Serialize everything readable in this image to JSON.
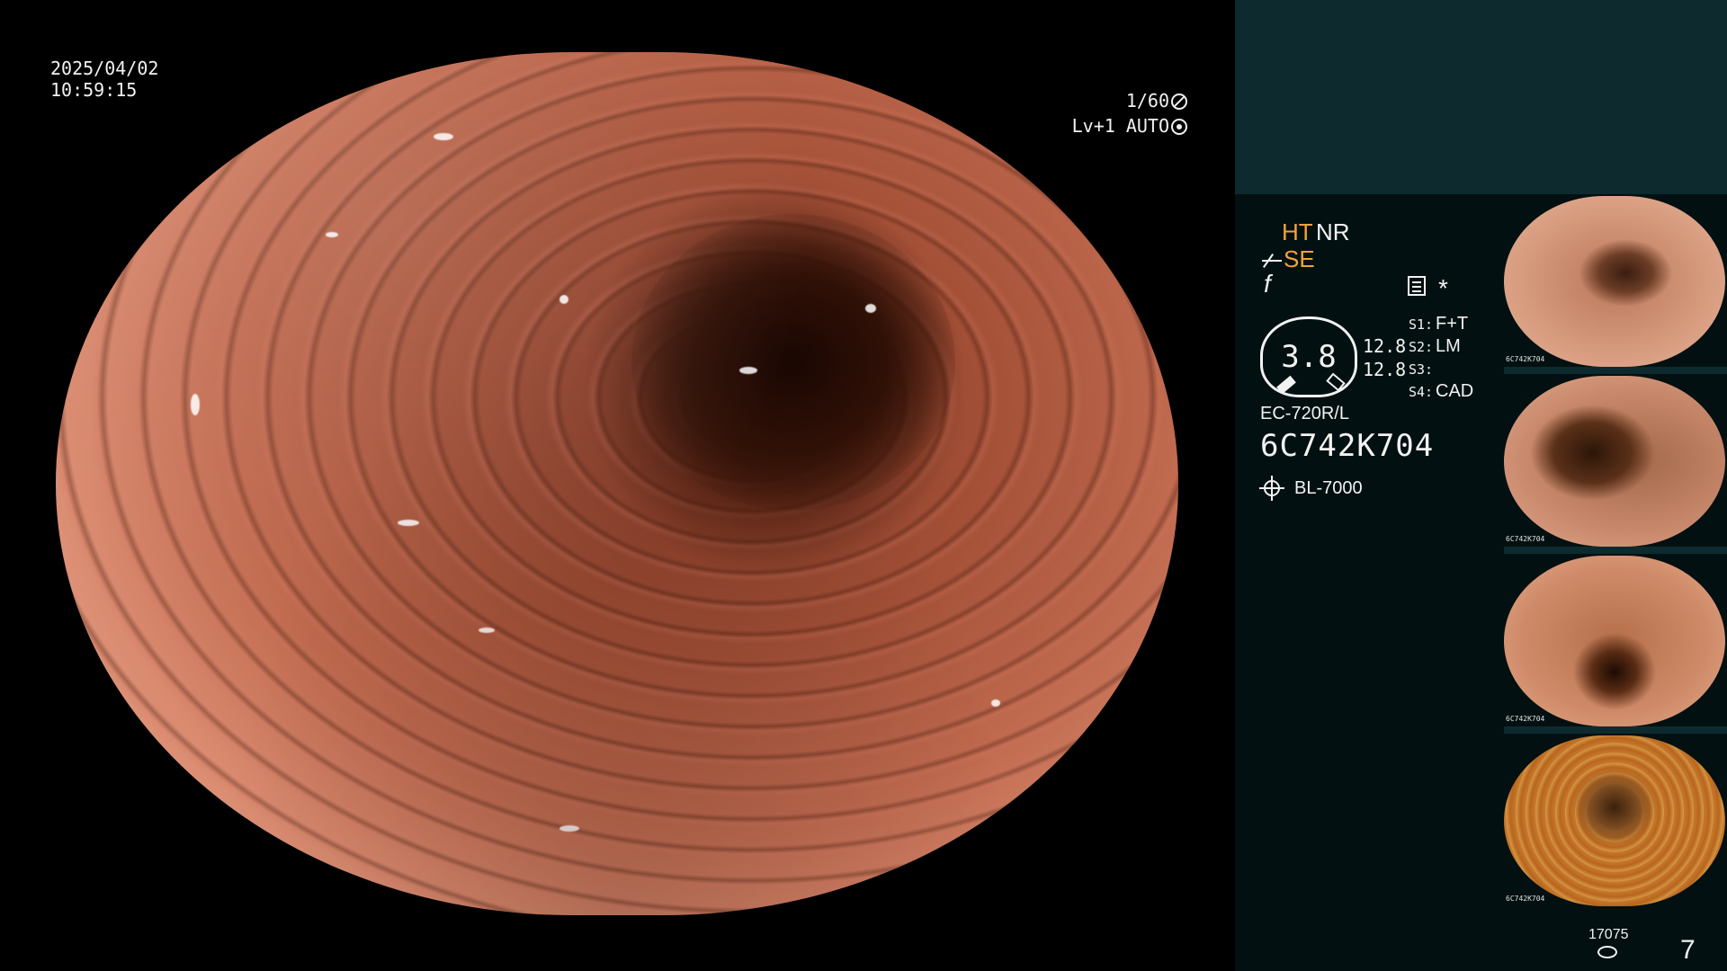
{
  "osd": {
    "date": "2025/04/02",
    "time": "10:59:15",
    "shutter": "1/60",
    "level": "Lv+1 AUTO"
  },
  "panel": {
    "ht": "HT",
    "nr": "NR",
    "se": "SE",
    "f_symbol": "f",
    "asterisk": "*",
    "gauge_value": "3.8",
    "nums": [
      "12.8",
      "12.8"
    ],
    "settings": [
      {
        "key": "S1:",
        "value": "F+T"
      },
      {
        "key": "S2:",
        "value": "LM"
      },
      {
        "key": "S3:",
        "value": ""
      },
      {
        "key": "S4:",
        "value": "CAD"
      }
    ],
    "scope_model": "EC-720R/L",
    "scope_serial": "6C742K704",
    "light_source": "BL-7000"
  },
  "thumbnails": [
    {
      "caption": "6C742K704"
    },
    {
      "caption": "6C742K704"
    },
    {
      "caption": "6C742K704"
    },
    {
      "caption": "6C742K704"
    }
  ],
  "footer": {
    "image_counter": "17075",
    "capture_count": "7"
  },
  "colors": {
    "panel_bg": "#031011",
    "panel_top": "#0d2b2e",
    "accent_orange": "#f2a33a"
  }
}
